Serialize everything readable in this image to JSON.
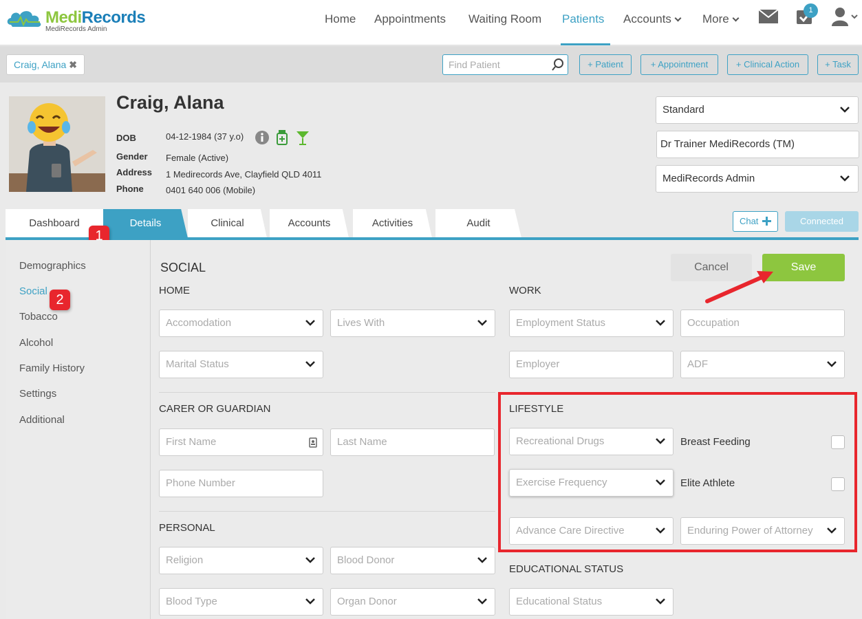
{
  "app": {
    "logo_title_a": "Medi",
    "logo_title_b": "Records",
    "logo_sub": "MediRecords Admin",
    "accent": "#3da1c4",
    "brand_green": "#8dc63f",
    "alert_red": "#e8262d"
  },
  "nav": {
    "home": "Home",
    "appointments": "Appointments",
    "waiting_room": "Waiting Room",
    "patients": "Patients",
    "accounts": "Accounts",
    "more": "More",
    "tasks_badge": "1",
    "icons": [
      "mail-icon",
      "tasks-check-icon",
      "user-icon"
    ]
  },
  "subbar": {
    "patient_chip": "Craig, Alana",
    "chip_close": "✖",
    "find_placeholder": "Find Patient",
    "add_patient": "+ Patient",
    "add_appointment": "+ Appointment",
    "add_clinical_action": "+ Clinical Action",
    "add_task": "+ Task"
  },
  "patient": {
    "name": "Craig, Alana",
    "dob_label": "DOB",
    "dob": "04-12-1984 (37 y.o)",
    "gender_label": "Gender",
    "gender": "Female (Active)",
    "address_label": "Address",
    "address": "1 Medirecords Ave, Clayfield QLD 4011",
    "phone_label": "Phone",
    "phone": "0401 640 006 (Mobile)",
    "status_icons": [
      "info-icon",
      "medication-icon",
      "alcohol-icon"
    ]
  },
  "header_selects": {
    "appointment_type": "Standard",
    "practitioner": "Dr Trainer MediRecords (TM)",
    "practice": "MediRecords Admin"
  },
  "tabs": [
    "Dashboard",
    "Details",
    "Clinical",
    "Accounts",
    "Activities",
    "Audit"
  ],
  "tab_actions": {
    "chat": "Chat",
    "connected": "Connected"
  },
  "steps": {
    "one": "1",
    "two": "2"
  },
  "side_menu": [
    "Demographics",
    "Social",
    "Tobacco",
    "Alcohol",
    "Family History",
    "Settings",
    "Additional"
  ],
  "social": {
    "title": "SOCIAL",
    "cancel": "Cancel",
    "save": "Save",
    "home_title": "HOME",
    "accomodation": "Accomodation",
    "lives_with": "Lives With",
    "marital_status": "Marital Status",
    "work_title": "WORK",
    "employment_status": "Employment Status",
    "occupation": "Occupation",
    "employer": "Employer",
    "adf": "ADF",
    "carer_title": "CARER OR GUARDIAN",
    "first_name": "First Name",
    "last_name": "Last Name",
    "phone_number": "Phone Number",
    "lifestyle_title": "LIFESTYLE",
    "recreational_drugs": "Recreational Drugs",
    "breast_feeding": "Breast Feeding",
    "exercise_frequency": "Exercise Frequency",
    "elite_athlete": "Elite Athlete",
    "advance_care": "Advance Care Directive",
    "enduring_poa": "Enduring Power of Attorney",
    "personal_title": "PERSONAL",
    "religion": "Religion",
    "blood_donor": "Blood Donor",
    "blood_type": "Blood Type",
    "organ_donor": "Organ Donor",
    "educational_title": "EDUCATIONAL STATUS",
    "educational_status": "Educational Status"
  }
}
